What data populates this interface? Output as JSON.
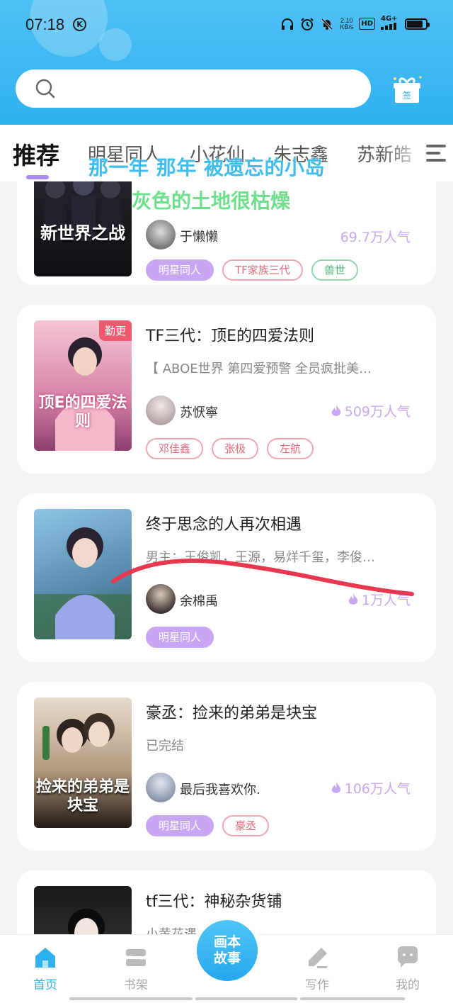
{
  "status_bar": {
    "time": "07:18",
    "k_badge": "K",
    "net_speed_value": "2.10",
    "net_speed_unit": "KB/s",
    "hd": "HD",
    "network": "4G+"
  },
  "search": {
    "placeholder": ""
  },
  "tabs": [
    {
      "label": "推荐",
      "active": true
    },
    {
      "label": "明星同人"
    },
    {
      "label": "小花仙"
    },
    {
      "label": "朱志鑫"
    },
    {
      "label": "苏新皓"
    }
  ],
  "overlay_text": {
    "line1": "那一年 那年 被遗忘的小岛",
    "line2": "灰色的土地很枯燥"
  },
  "books": [
    {
      "cover_text": "新世界之战",
      "title": "",
      "desc": "",
      "author": "于懒懒",
      "popularity": "69.7万人气",
      "tags": [
        {
          "label": "明星同人",
          "style": "purple"
        },
        {
          "label": "TF家族三代",
          "style": "red"
        },
        {
          "label": "兽世",
          "style": "green"
        }
      ],
      "cover_colors": [
        "#1b1b22",
        "#47475a"
      ]
    },
    {
      "cover_text": "顶E的四爱法则",
      "badge": "勤更",
      "title": "TF三代：顶E的四爱法则",
      "desc": "【 ABOE世界 第四爱预警 全员疯批美…",
      "author": "苏恹寧",
      "popularity": "509万人气",
      "tags": [
        {
          "label": "邓佳鑫",
          "style": "red"
        },
        {
          "label": "张极",
          "style": "red"
        },
        {
          "label": "左航",
          "style": "red"
        }
      ],
      "cover_colors": [
        "#e9a8c2",
        "#b1578a"
      ]
    },
    {
      "cover_text": "",
      "title": "终于思念的人再次相遇",
      "desc": "男主：王俊凯，王源，易烊千玺，李俊…",
      "author": "余棉禹",
      "popularity": "1万人气",
      "tags": [
        {
          "label": "明星同人",
          "style": "purple"
        }
      ],
      "cover_colors": [
        "#6f9fc5",
        "#3d6b87"
      ]
    },
    {
      "cover_text": "捡来的弟弟是块宝",
      "title": "豪丞：捡来的弟弟是块宝",
      "desc": "已完结",
      "author": "最后我喜欢你.",
      "popularity": "106万人气",
      "tags": [
        {
          "label": "明星同人",
          "style": "purple"
        },
        {
          "label": "豪丞",
          "style": "red"
        }
      ],
      "cover_colors": [
        "#d7c3ad",
        "#3b2f25"
      ]
    },
    {
      "cover_text": "",
      "title": "tf三代：神秘杂货铺",
      "desc": "小黄花遇…",
      "author": "",
      "popularity": "",
      "tags": [],
      "cover_colors": [
        "#121212",
        "#3a3a3a"
      ]
    }
  ],
  "bottom_nav": {
    "items": [
      {
        "label": "首页",
        "icon": "home-icon"
      },
      {
        "label": "书架",
        "icon": "bookshelf-icon"
      },
      {
        "label": "写作",
        "icon": "pen-icon"
      },
      {
        "label": "我的",
        "icon": "chat-face-icon"
      }
    ],
    "center": {
      "line1": "画本",
      "line2": "故事"
    }
  },
  "colors": {
    "header_blue": "#2fb1f0",
    "accent_purple": "#a98ef0",
    "tag_purple": "#c9a6f3",
    "popularity": "#c8a8f0",
    "scribble_red": "#e8384f"
  }
}
